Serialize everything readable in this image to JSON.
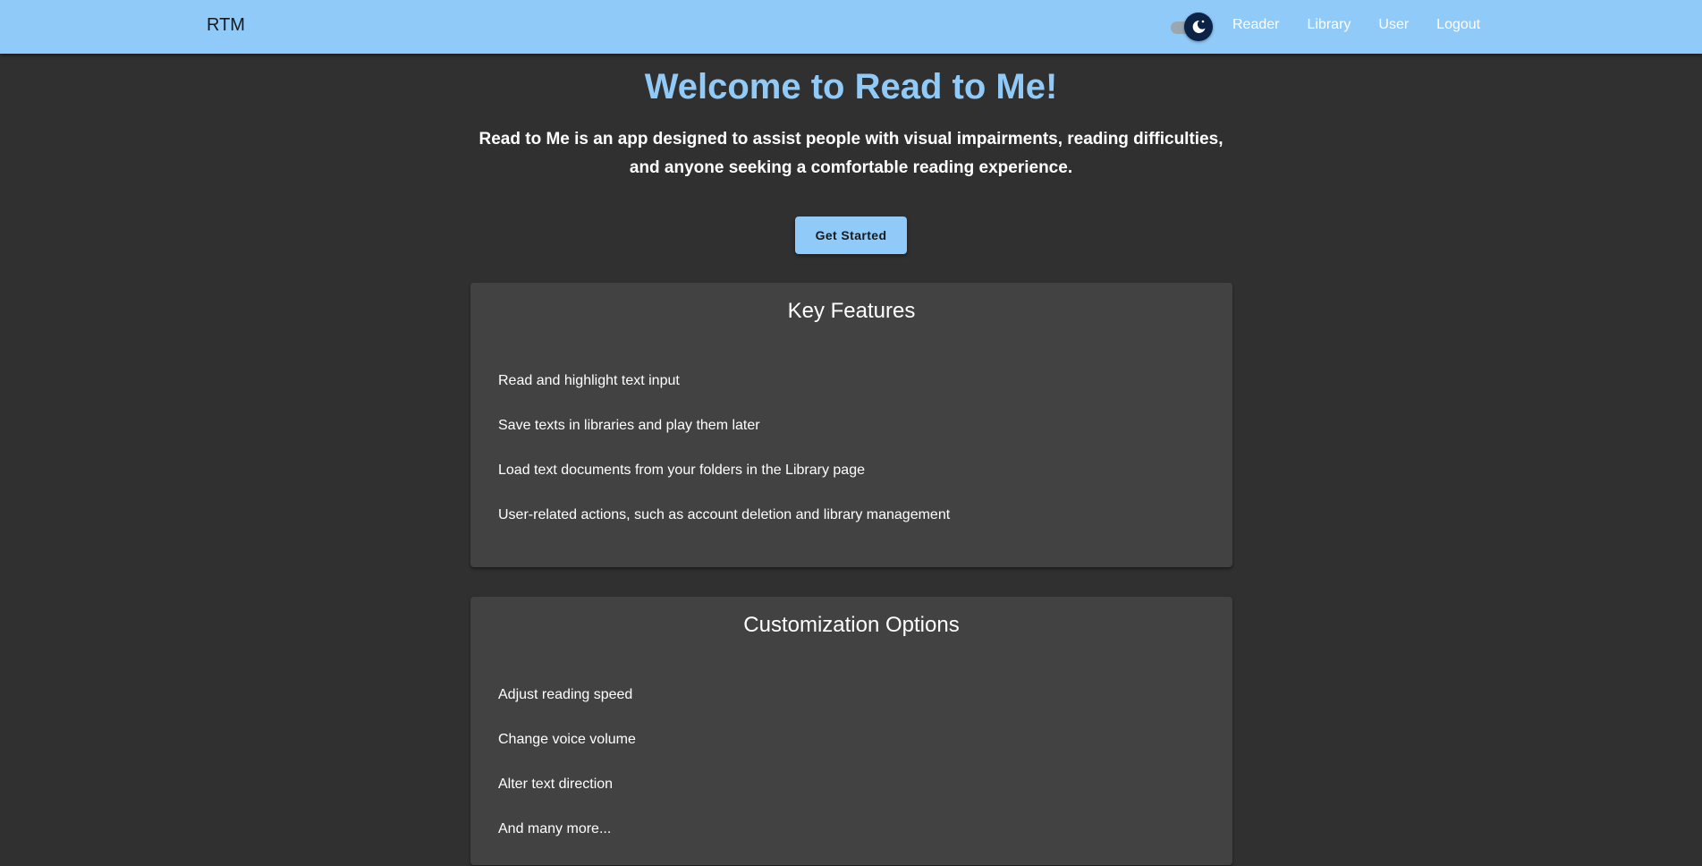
{
  "nav": {
    "brand": "RTM",
    "links": [
      "Reader",
      "Library",
      "User",
      "Logout"
    ],
    "theme_toggle_icon": "moon-icon",
    "theme_mode": "dark"
  },
  "hero": {
    "title": "Welcome to Read to Me!",
    "description": "Read to Me is an app designed to assist people with visual impairments, reading difficulties, and anyone seeking a comfortable reading experience.",
    "cta_label": "Get Started"
  },
  "sections": [
    {
      "title": "Key Features",
      "items": [
        "Read and highlight text input",
        "Save texts in libraries and play them later",
        "Load text documents from your folders in the Library page",
        "User-related actions, such as account deletion and library management"
      ]
    },
    {
      "title": "Customization Options",
      "items": [
        "Adjust reading speed",
        "Change voice volume",
        "Alter text direction",
        "And many more..."
      ]
    }
  ],
  "colors": {
    "navbar": "#90caf9",
    "background": "#303030",
    "card": "#424242",
    "accent": "#90caf9",
    "toggle_thumb": "#0b2347"
  }
}
